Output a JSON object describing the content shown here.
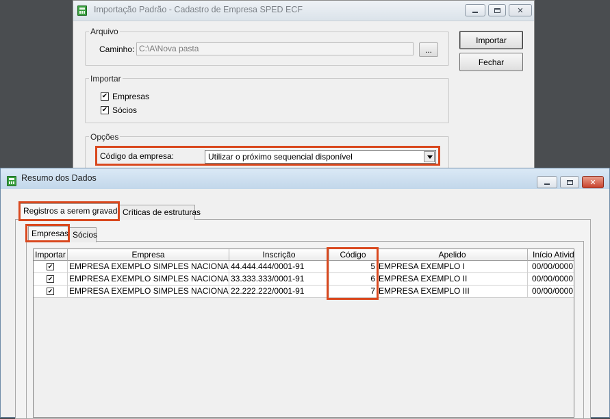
{
  "back_window": {
    "title": "Importação Padrão - Cadastro de Empresa SPED ECF",
    "arquivo": {
      "legend": "Arquivo",
      "caminho_label": "Caminho:",
      "caminho_value": "C:\\A\\Nova pasta",
      "browse_label": "..."
    },
    "importar": {
      "legend": "Importar",
      "empresas_label": "Empresas",
      "socios_label": "Sócios"
    },
    "opcoes": {
      "legend": "Opções",
      "codigo_label": "Código da empresa:",
      "codigo_value": "Utilizar o próximo sequencial disponível"
    },
    "importar_button": "Importar",
    "fechar_button": "Fechar"
  },
  "front_window": {
    "title": "Resumo dos Dados",
    "tabs": [
      "Registros a serem gravados",
      "Críticas de estruturas"
    ],
    "subtabs": [
      "Empresas",
      "Sócios"
    ],
    "columns": [
      "Importar",
      "Empresa",
      "Inscrição",
      "Código",
      "Apelido",
      "Início Atividade"
    ],
    "rows": [
      {
        "checked": "✔",
        "empresa": "EMPRESA EXEMPLO SIMPLES NACIONAL LTDA",
        "inscricao": "44.444.444/0001-91",
        "codigo": "5",
        "apelido": "EMPRESA EXEMPLO I",
        "inicio": "00/00/0000"
      },
      {
        "checked": "✔",
        "empresa": "EMPRESA EXEMPLO SIMPLES NACIONAL LTDA",
        "inscricao": "33.333.333/0001-91",
        "codigo": "6",
        "apelido": "EMPRESA EXEMPLO II",
        "inicio": "00/00/0000"
      },
      {
        "checked": "✔",
        "empresa": "EMPRESA EXEMPLO SIMPLES NACIONAL LTDA",
        "inscricao": "22.222.222/0001-91",
        "codigo": "7",
        "apelido": "EMPRESA EXEMPLO III",
        "inicio": "00/00/0000"
      }
    ]
  },
  "window_buttons": {
    "minimize": "minimize-icon",
    "maximize": "maximize-icon",
    "close": "✕"
  },
  "colors": {
    "highlight": "#d9481e"
  }
}
